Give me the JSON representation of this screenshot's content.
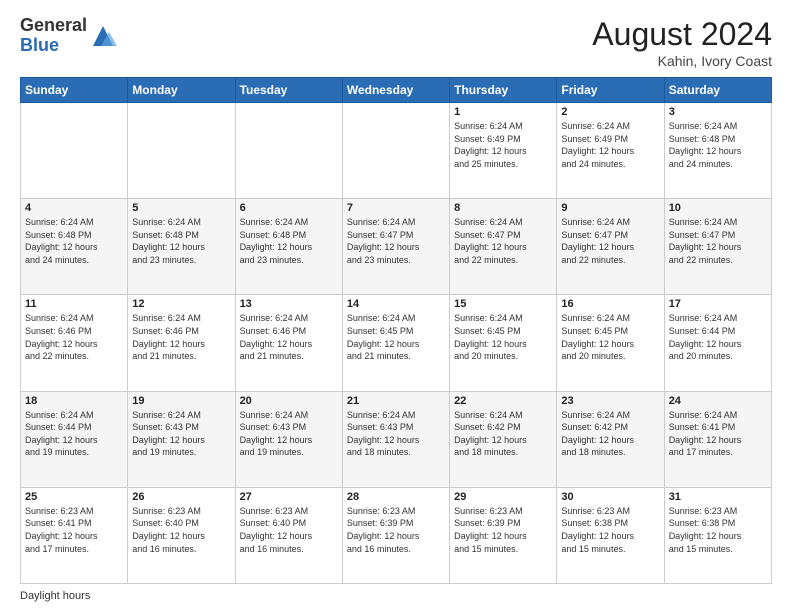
{
  "logo": {
    "general": "General",
    "blue": "Blue"
  },
  "title": "August 2024",
  "location": "Kahin, Ivory Coast",
  "days_of_week": [
    "Sunday",
    "Monday",
    "Tuesday",
    "Wednesday",
    "Thursday",
    "Friday",
    "Saturday"
  ],
  "weeks": [
    [
      {
        "day": "",
        "info": ""
      },
      {
        "day": "",
        "info": ""
      },
      {
        "day": "",
        "info": ""
      },
      {
        "day": "",
        "info": ""
      },
      {
        "day": "1",
        "info": "Sunrise: 6:24 AM\nSunset: 6:49 PM\nDaylight: 12 hours\nand 25 minutes."
      },
      {
        "day": "2",
        "info": "Sunrise: 6:24 AM\nSunset: 6:49 PM\nDaylight: 12 hours\nand 24 minutes."
      },
      {
        "day": "3",
        "info": "Sunrise: 6:24 AM\nSunset: 6:48 PM\nDaylight: 12 hours\nand 24 minutes."
      }
    ],
    [
      {
        "day": "4",
        "info": "Sunrise: 6:24 AM\nSunset: 6:48 PM\nDaylight: 12 hours\nand 24 minutes."
      },
      {
        "day": "5",
        "info": "Sunrise: 6:24 AM\nSunset: 6:48 PM\nDaylight: 12 hours\nand 23 minutes."
      },
      {
        "day": "6",
        "info": "Sunrise: 6:24 AM\nSunset: 6:48 PM\nDaylight: 12 hours\nand 23 minutes."
      },
      {
        "day": "7",
        "info": "Sunrise: 6:24 AM\nSunset: 6:47 PM\nDaylight: 12 hours\nand 23 minutes."
      },
      {
        "day": "8",
        "info": "Sunrise: 6:24 AM\nSunset: 6:47 PM\nDaylight: 12 hours\nand 22 minutes."
      },
      {
        "day": "9",
        "info": "Sunrise: 6:24 AM\nSunset: 6:47 PM\nDaylight: 12 hours\nand 22 minutes."
      },
      {
        "day": "10",
        "info": "Sunrise: 6:24 AM\nSunset: 6:47 PM\nDaylight: 12 hours\nand 22 minutes."
      }
    ],
    [
      {
        "day": "11",
        "info": "Sunrise: 6:24 AM\nSunset: 6:46 PM\nDaylight: 12 hours\nand 22 minutes."
      },
      {
        "day": "12",
        "info": "Sunrise: 6:24 AM\nSunset: 6:46 PM\nDaylight: 12 hours\nand 21 minutes."
      },
      {
        "day": "13",
        "info": "Sunrise: 6:24 AM\nSunset: 6:46 PM\nDaylight: 12 hours\nand 21 minutes."
      },
      {
        "day": "14",
        "info": "Sunrise: 6:24 AM\nSunset: 6:45 PM\nDaylight: 12 hours\nand 21 minutes."
      },
      {
        "day": "15",
        "info": "Sunrise: 6:24 AM\nSunset: 6:45 PM\nDaylight: 12 hours\nand 20 minutes."
      },
      {
        "day": "16",
        "info": "Sunrise: 6:24 AM\nSunset: 6:45 PM\nDaylight: 12 hours\nand 20 minutes."
      },
      {
        "day": "17",
        "info": "Sunrise: 6:24 AM\nSunset: 6:44 PM\nDaylight: 12 hours\nand 20 minutes."
      }
    ],
    [
      {
        "day": "18",
        "info": "Sunrise: 6:24 AM\nSunset: 6:44 PM\nDaylight: 12 hours\nand 19 minutes."
      },
      {
        "day": "19",
        "info": "Sunrise: 6:24 AM\nSunset: 6:43 PM\nDaylight: 12 hours\nand 19 minutes."
      },
      {
        "day": "20",
        "info": "Sunrise: 6:24 AM\nSunset: 6:43 PM\nDaylight: 12 hours\nand 19 minutes."
      },
      {
        "day": "21",
        "info": "Sunrise: 6:24 AM\nSunset: 6:43 PM\nDaylight: 12 hours\nand 18 minutes."
      },
      {
        "day": "22",
        "info": "Sunrise: 6:24 AM\nSunset: 6:42 PM\nDaylight: 12 hours\nand 18 minutes."
      },
      {
        "day": "23",
        "info": "Sunrise: 6:24 AM\nSunset: 6:42 PM\nDaylight: 12 hours\nand 18 minutes."
      },
      {
        "day": "24",
        "info": "Sunrise: 6:24 AM\nSunset: 6:41 PM\nDaylight: 12 hours\nand 17 minutes."
      }
    ],
    [
      {
        "day": "25",
        "info": "Sunrise: 6:23 AM\nSunset: 6:41 PM\nDaylight: 12 hours\nand 17 minutes."
      },
      {
        "day": "26",
        "info": "Sunrise: 6:23 AM\nSunset: 6:40 PM\nDaylight: 12 hours\nand 16 minutes."
      },
      {
        "day": "27",
        "info": "Sunrise: 6:23 AM\nSunset: 6:40 PM\nDaylight: 12 hours\nand 16 minutes."
      },
      {
        "day": "28",
        "info": "Sunrise: 6:23 AM\nSunset: 6:39 PM\nDaylight: 12 hours\nand 16 minutes."
      },
      {
        "day": "29",
        "info": "Sunrise: 6:23 AM\nSunset: 6:39 PM\nDaylight: 12 hours\nand 15 minutes."
      },
      {
        "day": "30",
        "info": "Sunrise: 6:23 AM\nSunset: 6:38 PM\nDaylight: 12 hours\nand 15 minutes."
      },
      {
        "day": "31",
        "info": "Sunrise: 6:23 AM\nSunset: 6:38 PM\nDaylight: 12 hours\nand 15 minutes."
      }
    ]
  ],
  "footer": {
    "daylight_label": "Daylight hours"
  }
}
